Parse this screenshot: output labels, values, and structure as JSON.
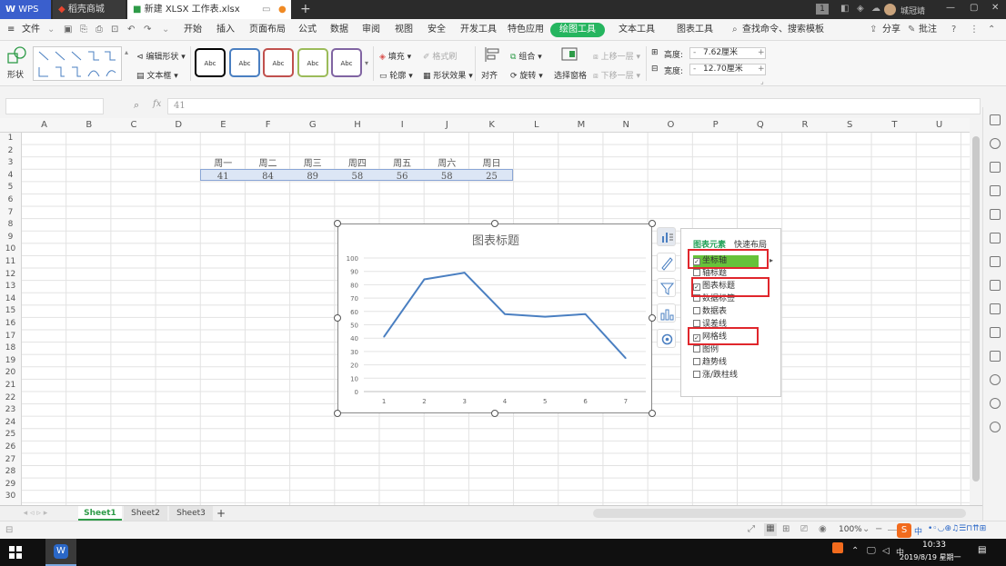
{
  "window": {
    "app_name": "WPS",
    "tabs": [
      {
        "label": "稻壳商城"
      },
      {
        "label": "新建 XLSX 工作表.xlsx"
      }
    ],
    "page_badge": "1",
    "user": "城冠靖"
  },
  "menu": {
    "file": "文件",
    "items": [
      "开始",
      "插入",
      "页面布局",
      "公式",
      "数据",
      "审阅",
      "视图",
      "安全",
      "开发工具",
      "特色应用",
      "绘图工具",
      "文本工具",
      "图表工具"
    ],
    "active": "绘图工具",
    "search": "查找命令、搜索模板",
    "share": "分享",
    "annotate": "批注"
  },
  "ribbon": {
    "shape_label": "形状",
    "edit_shape": "编辑形状",
    "text_box": "文本框",
    "style_samples": [
      "Abc",
      "Abc",
      "Abc",
      "Abc",
      "Abc"
    ],
    "style_colors": [
      "#000000",
      "#4a7fc1",
      "#c0504d",
      "#9bbb59",
      "#8064a2"
    ],
    "fill": "填充",
    "format_brush": "格式刷",
    "outline": "轮廓",
    "shape_effect": "形状效果",
    "align": "对齐",
    "group": "组合",
    "rotate": "旋转",
    "select_pane": "选择窗格",
    "bring_forward": "上移一层",
    "send_backward": "下移一层",
    "height_label": "高度:",
    "height_value": "7.62厘米",
    "width_label": "宽度:",
    "width_value": "12.70厘米"
  },
  "formula": {
    "fx": "fx",
    "value": "41"
  },
  "columns": [
    "A",
    "B",
    "C",
    "D",
    "E",
    "F",
    "G",
    "H",
    "I",
    "J",
    "K",
    "L",
    "M",
    "N",
    "O",
    "P",
    "Q",
    "R",
    "S",
    "T",
    "U"
  ],
  "rows": [
    "1",
    "2",
    "3",
    "4",
    "5",
    "6",
    "7",
    "8",
    "9",
    "10",
    "11",
    "12",
    "13",
    "14",
    "15",
    "16",
    "17",
    "18",
    "19",
    "20",
    "21",
    "22",
    "23",
    "24",
    "25",
    "26",
    "27",
    "28",
    "29",
    "30"
  ],
  "table": {
    "headers": [
      "周一",
      "周二",
      "周三",
      "周四",
      "周五",
      "周六",
      "周日"
    ],
    "values": [
      "41",
      "84",
      "89",
      "58",
      "56",
      "58",
      "25"
    ]
  },
  "chart_data": {
    "type": "line",
    "title": "图表标题",
    "categories": [
      "1",
      "2",
      "3",
      "4",
      "5",
      "6",
      "7"
    ],
    "values": [
      41,
      84,
      89,
      58,
      56,
      58,
      25
    ],
    "yticks": [
      "0",
      "10",
      "20",
      "30",
      "40",
      "50",
      "60",
      "70",
      "80",
      "90",
      "100"
    ],
    "ylim": [
      0,
      100
    ],
    "grid": true,
    "line_color": "#4a7fc1"
  },
  "chart_panel": {
    "tab_elements": "图表元素",
    "tab_layout": "快速布局",
    "items": [
      {
        "label": "坐标轴",
        "checked": true
      },
      {
        "label": "轴标题",
        "checked": false
      },
      {
        "label": "图表标题",
        "checked": true
      },
      {
        "label": "数据标签",
        "checked": false
      },
      {
        "label": "数据表",
        "checked": false
      },
      {
        "label": "误差线",
        "checked": false
      },
      {
        "label": "网格线",
        "checked": true
      },
      {
        "label": "图例",
        "checked": false
      },
      {
        "label": "趋势线",
        "checked": false
      },
      {
        "label": "涨/跌柱线",
        "checked": false
      }
    ]
  },
  "sheets": {
    "tabs": [
      "Sheet1",
      "Sheet2",
      "Sheet3"
    ],
    "active": "Sheet1"
  },
  "status": {
    "zoom": "100%"
  },
  "taskbar": {
    "time": "10:33",
    "date": "2019/8/19 星期一",
    "ime": "中"
  }
}
